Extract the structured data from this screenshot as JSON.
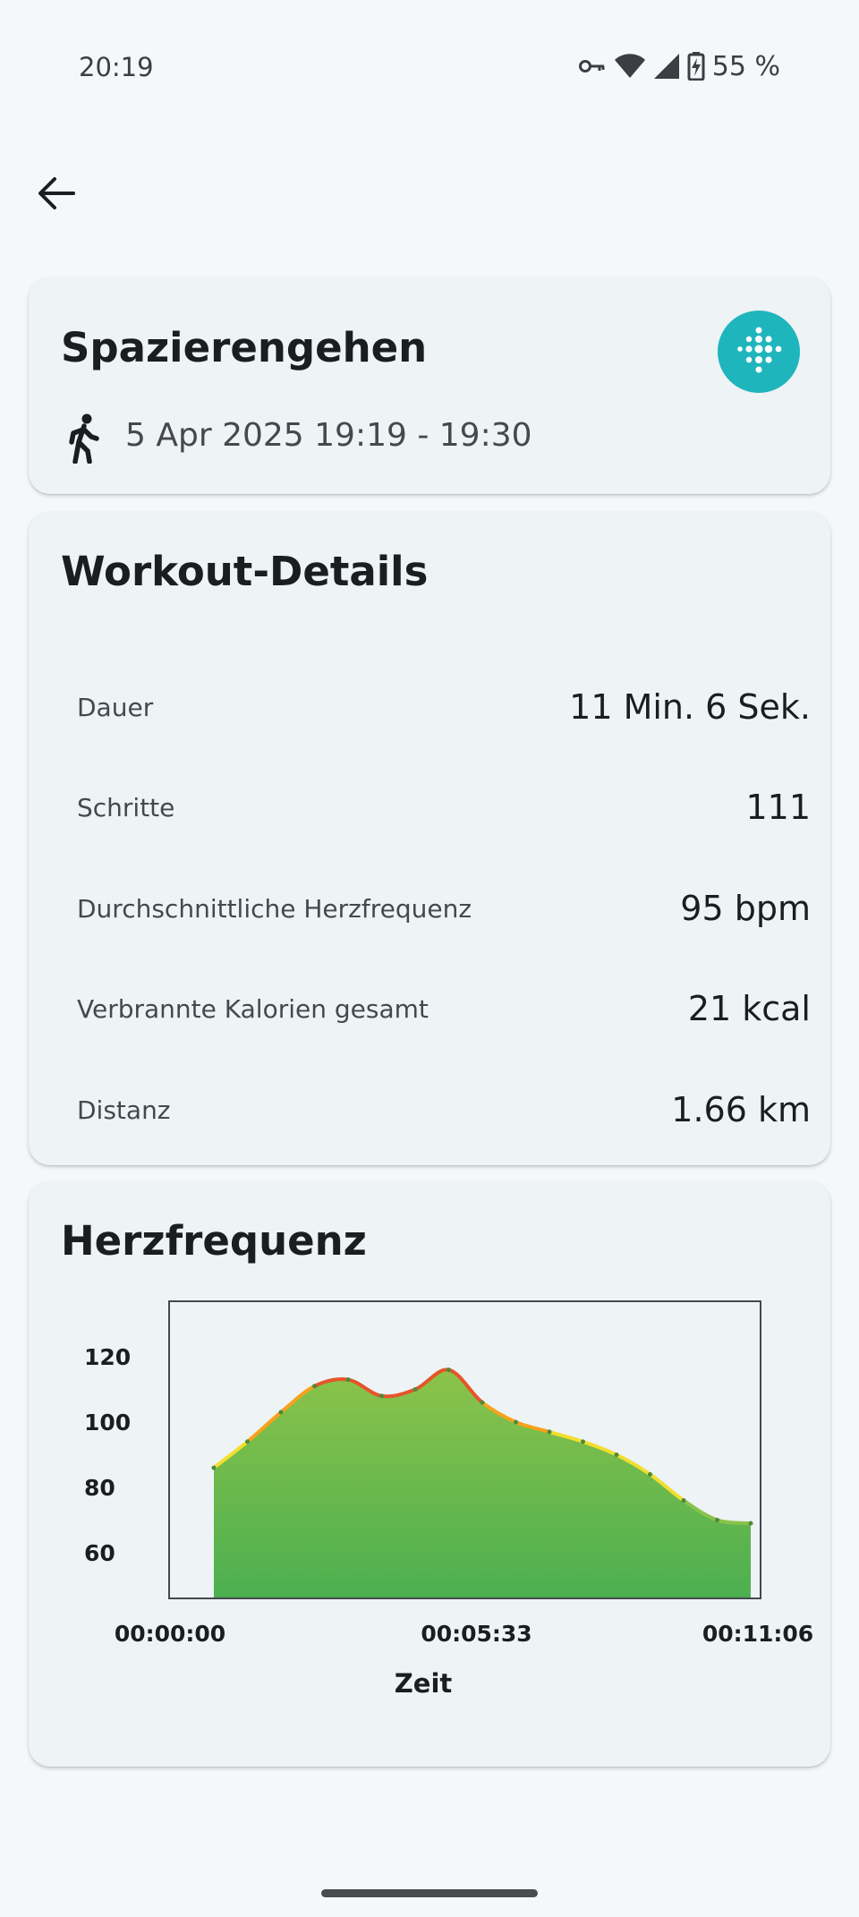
{
  "status_bar": {
    "time": "20:19",
    "battery": "55 %",
    "icons": [
      "vpn-key-icon",
      "wifi-icon",
      "cell-signal-icon",
      "battery-charging-icon"
    ]
  },
  "nav": {
    "back_icon": "arrow-left-icon"
  },
  "workout": {
    "title": "Spazierengehen",
    "time_range": "5 Apr 2025 19:19 - 19:30",
    "activity_icon": "walking-icon",
    "source_icon": "fitbit-icon",
    "source_color": "#1fb5bd"
  },
  "details": {
    "title": "Workout-Details",
    "rows": [
      {
        "label": "Dauer",
        "value": "11 Min. 6 Sek."
      },
      {
        "label": "Schritte",
        "value": "111"
      },
      {
        "label": "Durchschnittliche Herzfrequenz",
        "value": "95 bpm"
      },
      {
        "label": "Verbrannte Kalorien gesamt",
        "value": "21 kcal"
      },
      {
        "label": "Distanz",
        "value": "1.66 km"
      }
    ]
  },
  "heart_rate": {
    "title": "Herzfrequenz",
    "colors": {
      "fill_top": "#8bc34a",
      "fill_bottom": "#4caf50",
      "line_high": "#e5552a",
      "line_mid": "#f7a21b",
      "line_low": "#f2de2e"
    }
  },
  "chart_data": {
    "type": "area",
    "title": "Herzfrequenz",
    "xlabel": "Zeit",
    "ylabel": "",
    "x": [
      "00:00:00",
      "00:00:40",
      "00:01:20",
      "00:02:00",
      "00:02:40",
      "00:03:20",
      "00:04:00",
      "00:04:40",
      "00:05:20",
      "00:06:00",
      "00:06:40",
      "00:07:20",
      "00:08:00",
      "00:08:40",
      "00:09:20",
      "00:10:00",
      "00:10:40"
    ],
    "values": [
      86,
      94,
      103,
      111,
      113,
      108,
      110,
      116,
      106,
      100,
      97,
      94,
      90,
      84,
      76,
      70,
      69
    ],
    "x_tick_labels": [
      "00:00:00",
      "00:05:33",
      "00:11:06"
    ],
    "y_ticks": [
      60,
      80,
      100,
      120
    ],
    "ylim": [
      46,
      137
    ],
    "xlim_seconds": [
      0,
      666
    ],
    "grid": false
  }
}
